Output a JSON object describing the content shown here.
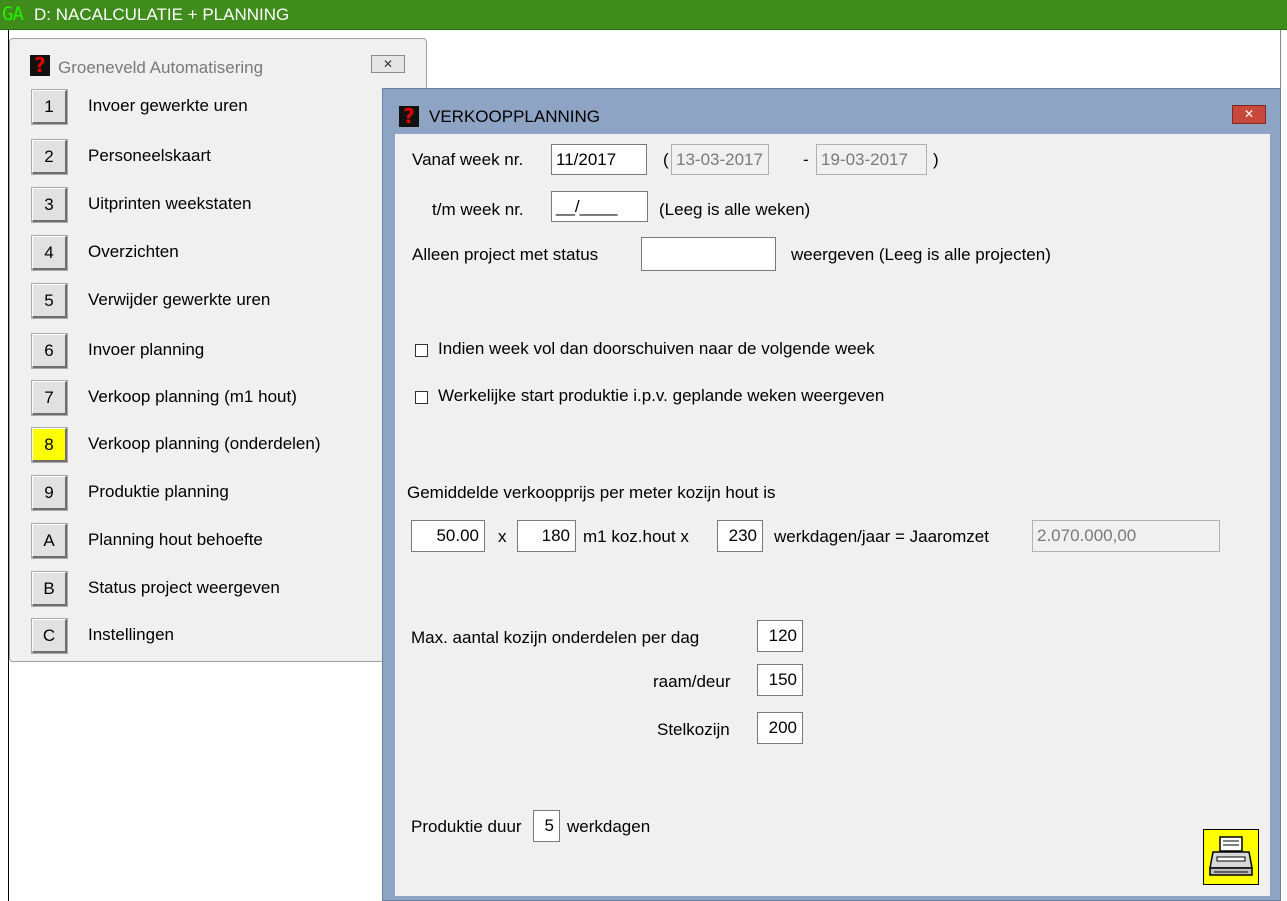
{
  "app": {
    "logo": "GA",
    "title": "D: NACALCULATIE + PLANNING"
  },
  "menu_window": {
    "title": "Groeneveld Automatisering",
    "items": [
      {
        "key": "1",
        "label": "Invoer gewerkte uren"
      },
      {
        "key": "2",
        "label": "Personeelskaart"
      },
      {
        "key": "3",
        "label": "Uitprinten weekstaten"
      },
      {
        "key": "4",
        "label": "Overzichten"
      },
      {
        "key": "5",
        "label": "Verwijder gewerkte uren"
      },
      {
        "key": "6",
        "label": "Invoer planning"
      },
      {
        "key": "7",
        "label": "Verkoop planning  (m1 hout)"
      },
      {
        "key": "8",
        "label": "Verkoop planning  (onderdelen)"
      },
      {
        "key": "9",
        "label": "Produktie planning"
      },
      {
        "key": "A",
        "label": "Planning hout behoefte"
      },
      {
        "key": "B",
        "label": "Status project weergeven"
      },
      {
        "key": "C",
        "label": "Instellingen"
      }
    ],
    "active_key": "8",
    "active_color": "#ffff00"
  },
  "dialog": {
    "title": "VERKOOPPLANNING",
    "from_week_label": "Vanaf week nr.",
    "from_week_value": "11/2017",
    "paren_open": "(",
    "date_from": "13-03-2017",
    "dash": "-",
    "date_to": "19-03-2017",
    "paren_close": ")",
    "to_week_label": "t/m week nr.",
    "to_week_value": "__/____",
    "to_week_hint": "(Leeg is alle weken)",
    "status_label": "Alleen project met status",
    "status_value": "",
    "status_hint": "weergeven (Leeg is alle projecten)",
    "check_shift_label": "Indien week vol dan doorschuiven naar de volgende week",
    "check_shift_checked": false,
    "check_actual_label": "Werkelijke start produktie i.p.v. geplande weken weergeven",
    "check_actual_checked": false,
    "avg_price_label": "Gemiddelde verkoopprijs per meter kozijn hout is",
    "price_value": "50.00",
    "times1": "x",
    "meters_value": "180",
    "meters_label": "m1 koz.hout x",
    "workdays_value": "230",
    "workdays_label": "werkdagen/jaar = Jaaromzet",
    "annual_revenue": "2.070.000,00",
    "max_parts_label": "Max. aantal kozijn onderdelen per dag",
    "max_parts_value": "120",
    "window_door_label": "raam/deur",
    "window_door_value": "150",
    "stelkozijn_label": "Stelkozijn",
    "stelkozijn_value": "200",
    "production_label": "Produktie duur",
    "production_value": "5",
    "production_unit": "werkdagen"
  },
  "colors": {
    "appbar": "#3f8b1c",
    "dialog_frame": "#8ea4c4",
    "close_button": "#c9483c",
    "print_button": "#ffff00"
  }
}
